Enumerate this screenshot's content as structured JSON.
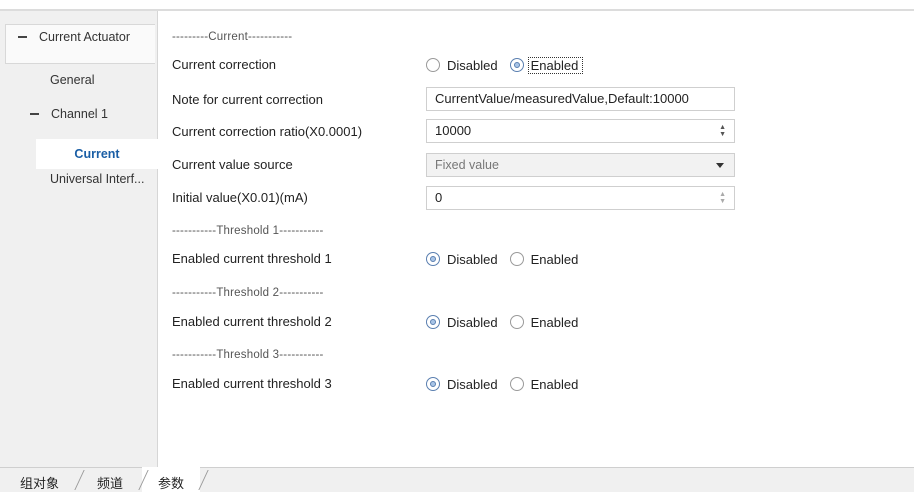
{
  "sidebar": {
    "header": "Current Actuator",
    "items": [
      {
        "label": "General"
      },
      {
        "label": "Channel 1"
      },
      {
        "label": "Current"
      },
      {
        "label": "Universal Interf..."
      }
    ]
  },
  "main": {
    "section_current": "---------Current-----------",
    "current_correction": {
      "label": "Current correction",
      "opt1": "Disabled",
      "opt2": "Enabled",
      "selected": "Enabled"
    },
    "note": {
      "label": "Note for current correction",
      "value": "CurrentValue/measuredValue,Default:10000"
    },
    "ratio": {
      "label": "Current correction ratio(X0.0001)",
      "value": "10000"
    },
    "source": {
      "label": "Current value source",
      "value": "Fixed value"
    },
    "initial": {
      "label": "Initial value(X0.01)(mA)",
      "value": "0"
    },
    "section_t1": "-----------Threshold 1-----------",
    "t1": {
      "label": "Enabled current threshold 1",
      "opt1": "Disabled",
      "opt2": "Enabled",
      "selected": "Disabled"
    },
    "section_t2": "-----------Threshold 2-----------",
    "t2": {
      "label": "Enabled current threshold 2",
      "opt1": "Disabled",
      "opt2": "Enabled",
      "selected": "Disabled"
    },
    "section_t3": "-----------Threshold 3-----------",
    "t3": {
      "label": "Enabled current threshold 3",
      "opt1": "Disabled",
      "opt2": "Enabled",
      "selected": "Disabled"
    }
  },
  "tabs": [
    {
      "label": "组对象"
    },
    {
      "label": "频道"
    },
    {
      "label": "参数"
    }
  ],
  "colors": {
    "selected_text": "#1a5ea5",
    "radio_border_on": "#5a7fb0",
    "radio_fill_on": "#a8c4e6"
  }
}
